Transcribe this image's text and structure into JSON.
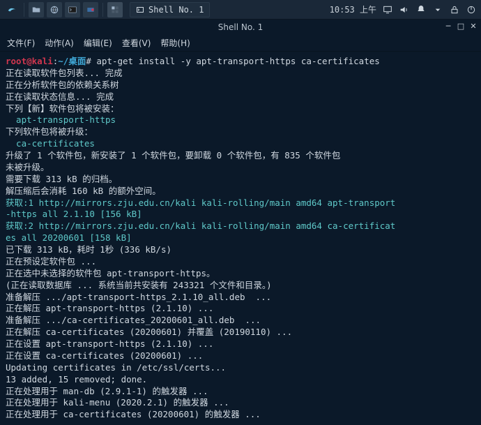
{
  "taskbar": {
    "active_app_label": "Shell No. 1",
    "clock": "10:53 上午"
  },
  "window": {
    "title": "Shell No. 1"
  },
  "menubar": {
    "file": "文件(F)",
    "actions": "动作(A)",
    "edit": "编辑(E)",
    "view": "查看(V)",
    "help": "帮助(H)"
  },
  "terminal": {
    "prompt_user": "root@kali",
    "prompt_sep": ":",
    "prompt_path": "~/桌面",
    "prompt_hash": "#",
    "command": "apt-get install -y apt-transport-https ca-certificates",
    "lines": {
      "l1": "正在读取软件包列表... 完成",
      "l2": "正在分析软件包的依赖关系树",
      "l3": "正在读取状态信息... 完成",
      "l4": "下列【新】软件包将被安装：",
      "l5": "  apt-transport-https",
      "l6": "下列软件包将被升级：",
      "l7": "  ca-certificates",
      "l8": "升级了 1 个软件包，新安装了 1 个软件包，要卸载 0 个软件包，有 835 个软件包",
      "l9": "未被升级。",
      "l10": "需要下载 313 kB 的归档。",
      "l11": "解压缩后会消耗 160 kB 的额外空间。",
      "l12": "获取:1 http://mirrors.zju.edu.cn/kali kali-rolling/main amd64 apt-transport",
      "l13": "-https all 2.1.10 [156 kB]",
      "l14": "获取:2 http://mirrors.zju.edu.cn/kali kali-rolling/main amd64 ca-certificat",
      "l15": "es all 20200601 [158 kB]",
      "l16": "已下载 313 kB，耗时 1秒 (336 kB/s)",
      "l17": "正在预设定软件包 ...",
      "l18a": "正在选中未选择的软件包 ",
      "l18b": "apt-transport-https",
      "l18c": "。",
      "l19": "(正在读取数据库 ... 系统当前共安装有 243321 个文件和目录。)",
      "l20": "准备解压 .../apt-transport-https_2.1.10_all.deb  ...",
      "l21": "正在解压 apt-transport-https (2.1.10) ...",
      "l22": "准备解压 .../ca-certificates_20200601_all.deb  ...",
      "l23": "正在解压 ca-certificates (20200601) 并覆盖 (20190110) ...",
      "l24": "正在设置 apt-transport-https (2.1.10) ...",
      "l25": "正在设置 ca-certificates (20200601) ...",
      "l26": "Updating certificates in /etc/ssl/certs...",
      "l27": "13 added, 15 removed; done.",
      "l28": "正在处理用于 man-db (2.9.1-1) 的触发器 ...",
      "l29": "正在处理用于 kali-menu (2020.2.1) 的触发器 ...",
      "l30": "正在处理用于 ca-certificates (20200601) 的触发器 ..."
    }
  }
}
